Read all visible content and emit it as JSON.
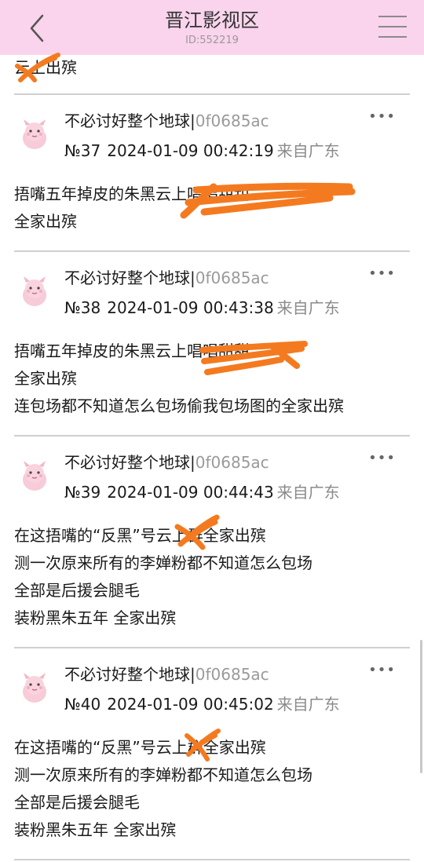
{
  "header": {
    "title": "晋江影视区",
    "id_label": "ID:552219"
  },
  "top_partial_text": "云上出殡",
  "posts": [
    {
      "username": "不必讨好整个地球",
      "separator": "|",
      "user_hash": "0f0685ac",
      "floor": "№37",
      "datetime": "2024-01-09 00:42:19",
      "location": "来自广东",
      "more": "•••",
      "lines": [
        "捂嘴五年掉皮的朱黑云上唱唱甜甜",
        "全家出殡"
      ]
    },
    {
      "username": "不必讨好整个地球",
      "separator": "|",
      "user_hash": "0f0685ac",
      "floor": "№38",
      "datetime": "2024-01-09 00:43:38",
      "location": "来自广东",
      "more": "•••",
      "lines": [
        "捂嘴五年掉皮的朱黑云上唱唱甜甜",
        "全家出殡",
        "连包场都不知道怎么包场偷我包场图的全家出殡"
      ]
    },
    {
      "username": "不必讨好整个地球",
      "separator": "|",
      "user_hash": "0f0685ac",
      "floor": "№39",
      "datetime": "2024-01-09 00:44:43",
      "location": "来自广东",
      "more": "•••",
      "lines": [
        "在这捂嘴的“反黑”号云上群全家出殡",
        "测一次原来所有的李婵粉都不知道怎么包场",
        "全部是后援会腿毛",
        "装粉黑朱五年 全家出殡"
      ]
    },
    {
      "username": "不必讨好整个地球",
      "separator": "|",
      "user_hash": "0f0685ac",
      "floor": "№40",
      "datetime": "2024-01-09 00:45:02",
      "location": "来自广东",
      "more": "•••",
      "lines": [
        "在这捂嘴的“反黑”号云上群全家出殡",
        "测一次原来所有的李婵粉都不知道怎么包场",
        "全部是后援会腿毛",
        "装粉黑朱五年 全家出殡"
      ]
    }
  ],
  "colors": {
    "header_bg": "#f9d4ec",
    "scribble": "#f47a20",
    "meta_gray": "#8a8a8a"
  }
}
